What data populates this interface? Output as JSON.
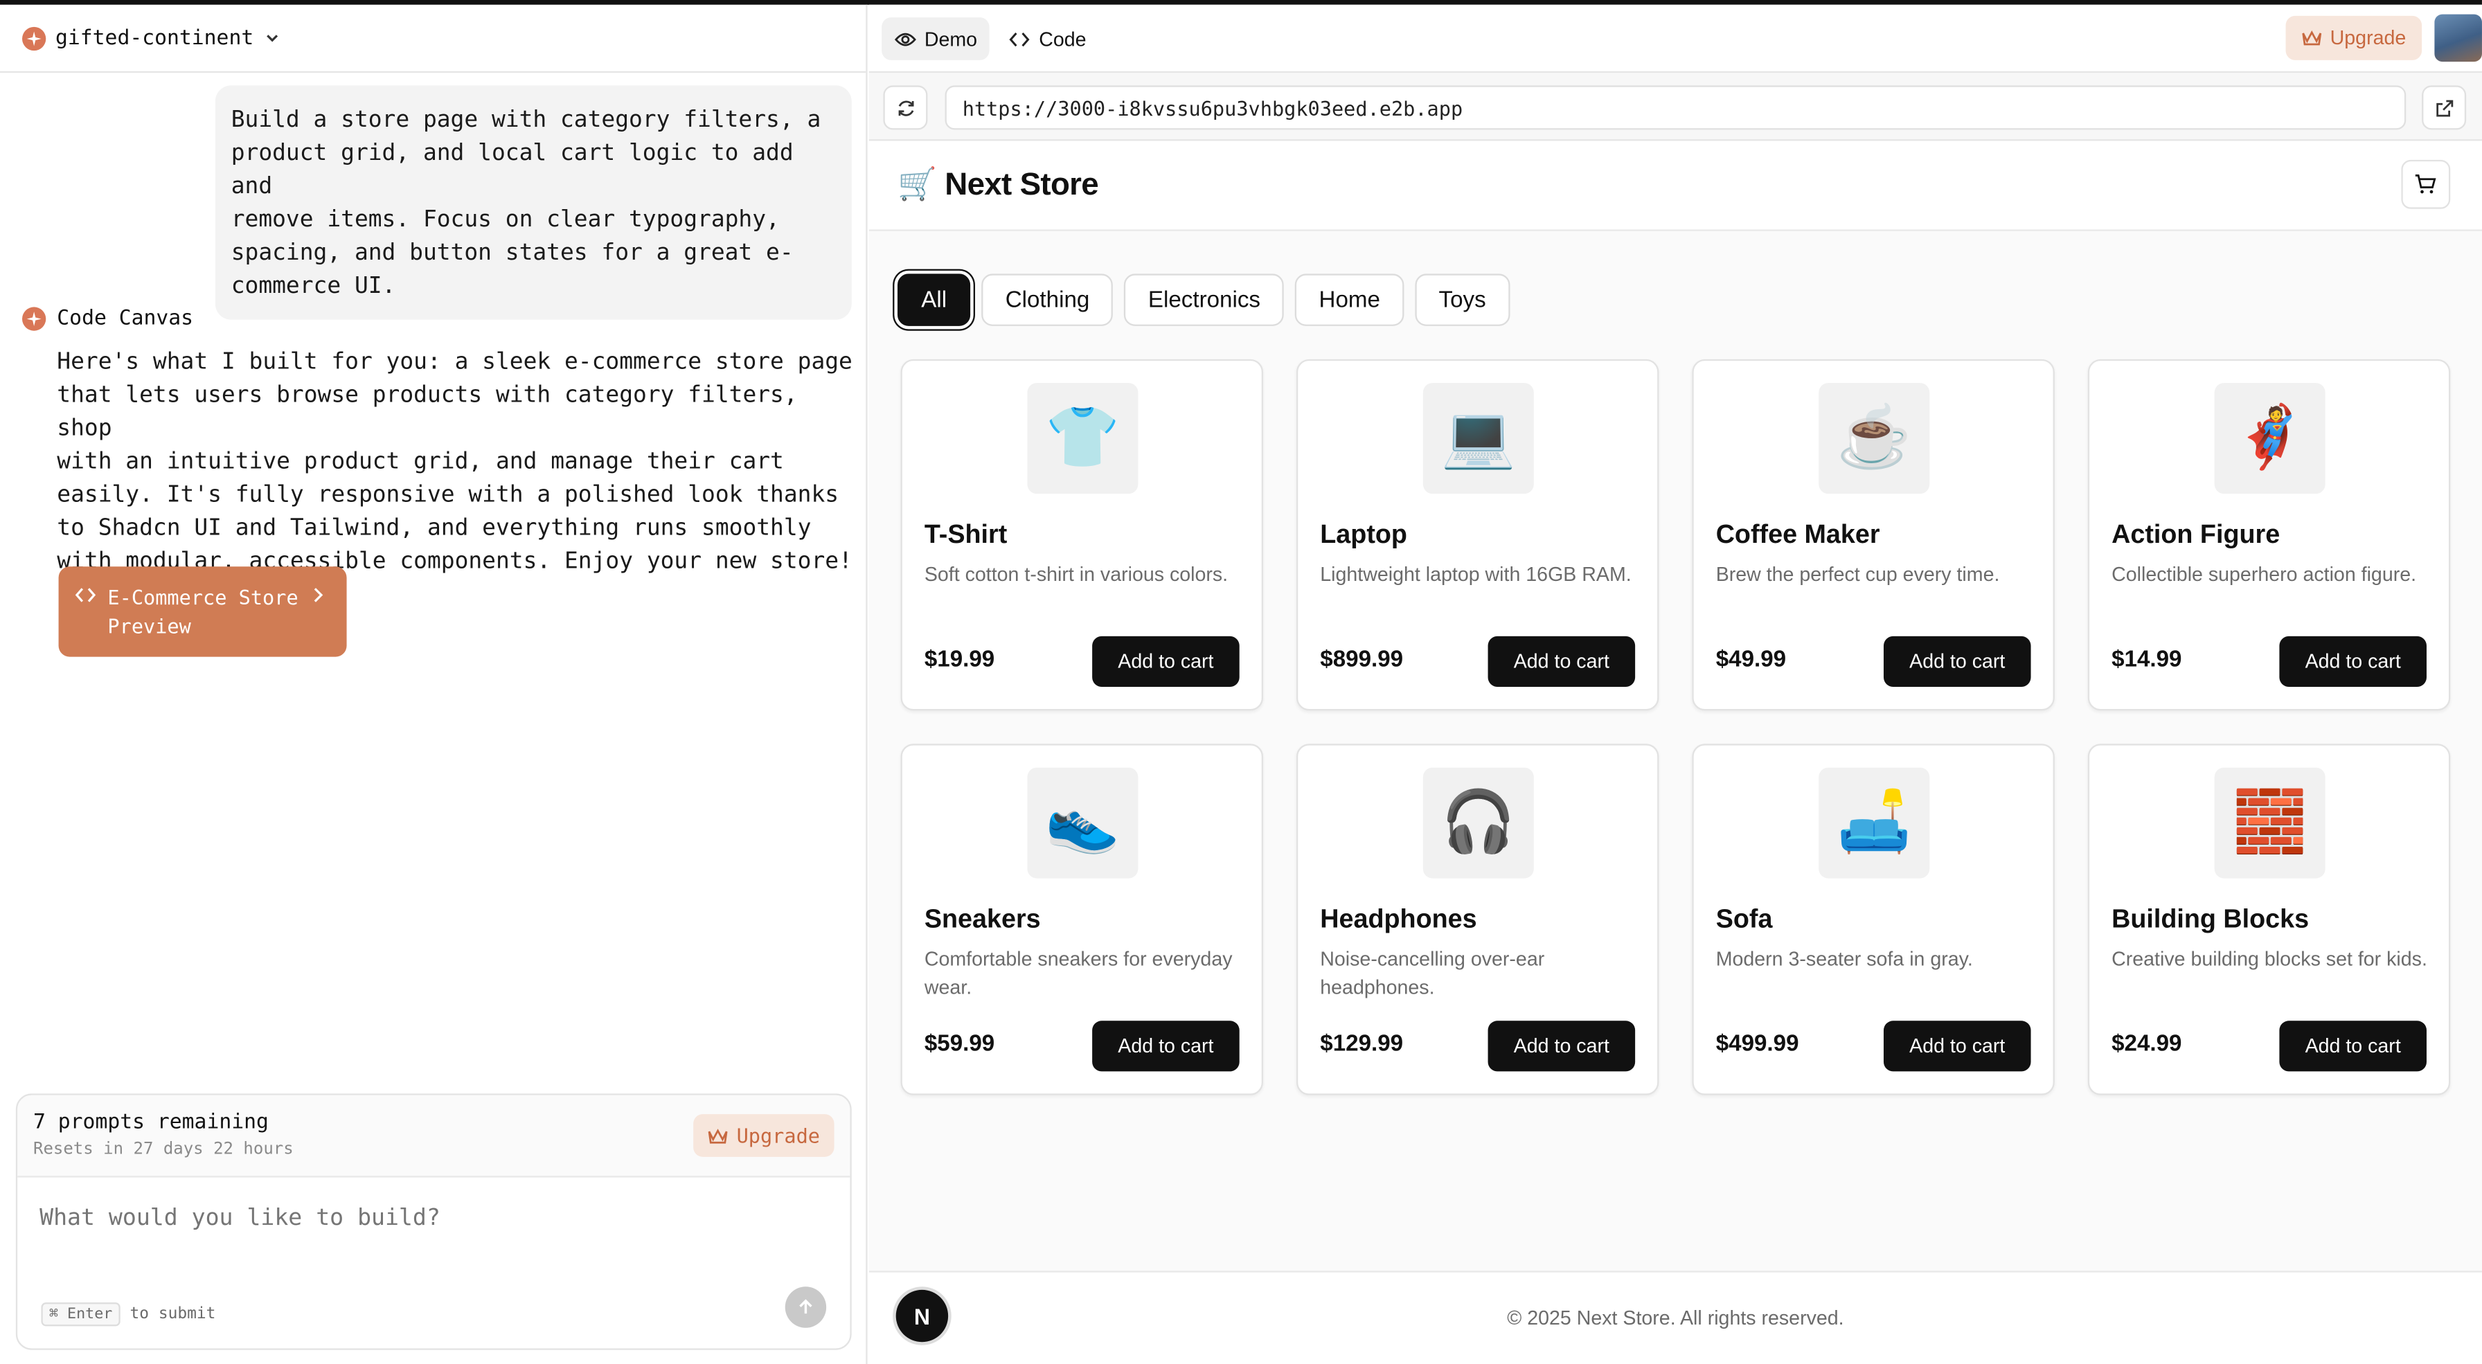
{
  "colors": {
    "accent": "#d07c54",
    "upgrade_bg": "#f7e6dc",
    "upgrade_fg": "#c7683f",
    "dark": "#111111"
  },
  "sidebar": {
    "project_name": "gifted-continent",
    "user_message": "Build a store page with category filters, a\nproduct grid, and local cart logic to add and\nremove items. Focus on clear typography,\nspacing, and button states for a great e-\ncommerce UI.",
    "assistant_name": "Code Canvas",
    "assistant_message": "Here's what I built for you: a sleek e-commerce store page\nthat lets users browse products with category filters, shop\nwith an intuitive product grid, and manage their cart\neasily. It's fully responsive with a polished look thanks\nto Shadcn UI and Tailwind, and everything runs smoothly\nwith modular, accessible components. Enjoy your new store!",
    "preview_button": "E-Commerce Store\nPreview",
    "prompts_remaining": "7 prompts remaining",
    "resets_text": "Resets in 27 days 22 hours",
    "upgrade_label": "Upgrade",
    "input_placeholder": "What would you like to build?",
    "enter_key": "⌘ Enter",
    "enter_hint": "to submit"
  },
  "toolbar": {
    "tabs": [
      {
        "label": "Demo",
        "icon": "eye-icon"
      },
      {
        "label": "Code",
        "icon": "code-icon"
      }
    ],
    "upgrade_label": "Upgrade",
    "url": "https://3000-i8kvssu6pu3vhbgk03eed.e2b.app"
  },
  "store": {
    "title": "🛒 Next Store",
    "filters": [
      "All",
      "Clothing",
      "Electronics",
      "Home",
      "Toys"
    ],
    "active_filter": "All",
    "add_label": "Add to cart",
    "products": [
      {
        "emoji": "👕",
        "name": "T-Shirt",
        "description": "Soft cotton t-shirt in various colors.",
        "price": "$19.99"
      },
      {
        "emoji": "💻",
        "name": "Laptop",
        "description": "Lightweight laptop with 16GB RAM.",
        "price": "$899.99"
      },
      {
        "emoji": "☕",
        "name": "Coffee Maker",
        "description": "Brew the perfect cup every time.",
        "price": "$49.99"
      },
      {
        "emoji": "🦸",
        "name": "Action Figure",
        "description": "Collectible superhero action figure.",
        "price": "$14.99"
      },
      {
        "emoji": "👟",
        "name": "Sneakers",
        "description": "Comfortable sneakers for everyday wear.",
        "price": "$59.99"
      },
      {
        "emoji": "🎧",
        "name": "Headphones",
        "description": "Noise-cancelling over-ear headphones.",
        "price": "$129.99"
      },
      {
        "emoji": "🛋️",
        "name": "Sofa",
        "description": "Modern 3-seater sofa in gray.",
        "price": "$499.99"
      },
      {
        "emoji": "🧱",
        "name": "Building Blocks",
        "description": "Creative building blocks set for kids.",
        "price": "$24.99"
      }
    ],
    "footer": "© 2025 Next Store. All rights reserved.",
    "next_badge": "N"
  }
}
